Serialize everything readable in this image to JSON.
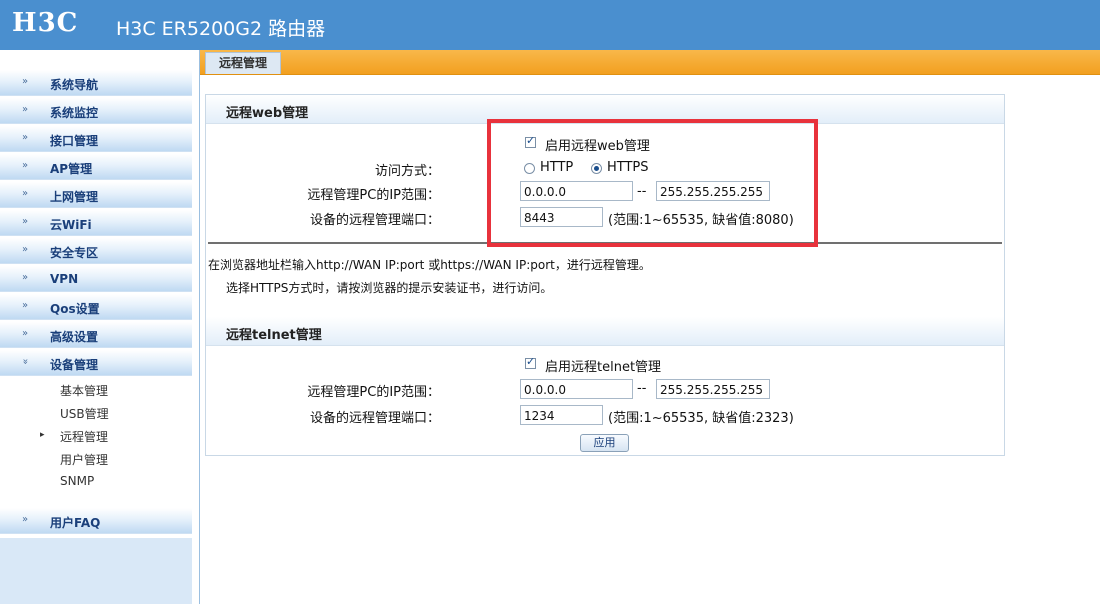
{
  "header": {
    "logo": "H3C",
    "title": "H3C ER5200G2 路由器"
  },
  "sidebar": {
    "items": [
      {
        "label": "系统导航"
      },
      {
        "label": "系统监控"
      },
      {
        "label": "接口管理"
      },
      {
        "label": "AP管理"
      },
      {
        "label": "上网管理"
      },
      {
        "label": "云WiFi"
      },
      {
        "label": "安全专区"
      },
      {
        "label": "VPN"
      },
      {
        "label": "Qos设置"
      },
      {
        "label": "高级设置"
      },
      {
        "label": "设备管理"
      }
    ],
    "sub_items": [
      {
        "label": "基本管理"
      },
      {
        "label": "USB管理"
      },
      {
        "label": "远程管理"
      },
      {
        "label": "用户管理"
      },
      {
        "label": "SNMP"
      }
    ],
    "faq": "用户FAQ"
  },
  "tab": {
    "label": "远程管理"
  },
  "web": {
    "heading": "远程web管理",
    "enable_label": "启用远程web管理",
    "access_label": "访问方式：",
    "http_label": "HTTP",
    "https_label": "HTTPS",
    "ip_range_label": "远程管理PC的IP范围：",
    "ip_start": "0.0.0.0",
    "dash": "--",
    "ip_end": "255.255.255.255",
    "port_label": "设备的远程管理端口：",
    "port": "8443",
    "port_hint": "(范围:1~65535, 缺省值:8080)"
  },
  "notes": {
    "line1": "在浏览器地址栏输入http://WAN IP:port 或https://WAN IP:port，进行远程管理。",
    "line2": "选择HTTPS方式时，请按浏览器的提示安装证书，进行访问。"
  },
  "telnet": {
    "heading": "远程telnet管理",
    "enable_label": "启用远程telnet管理",
    "ip_range_label": "远程管理PC的IP范围：",
    "ip_start": "0.0.0.0",
    "dash": "--",
    "ip_end": "255.255.255.255",
    "port_label": "设备的远程管理端口：",
    "port": "1234",
    "port_hint": "(范围:1~65535, 缺省值:2323)"
  },
  "apply_label": "应用",
  "colors": {
    "header": "#4a8fcf",
    "tabbar": "#f2a020",
    "highlight": "#e8323c"
  }
}
